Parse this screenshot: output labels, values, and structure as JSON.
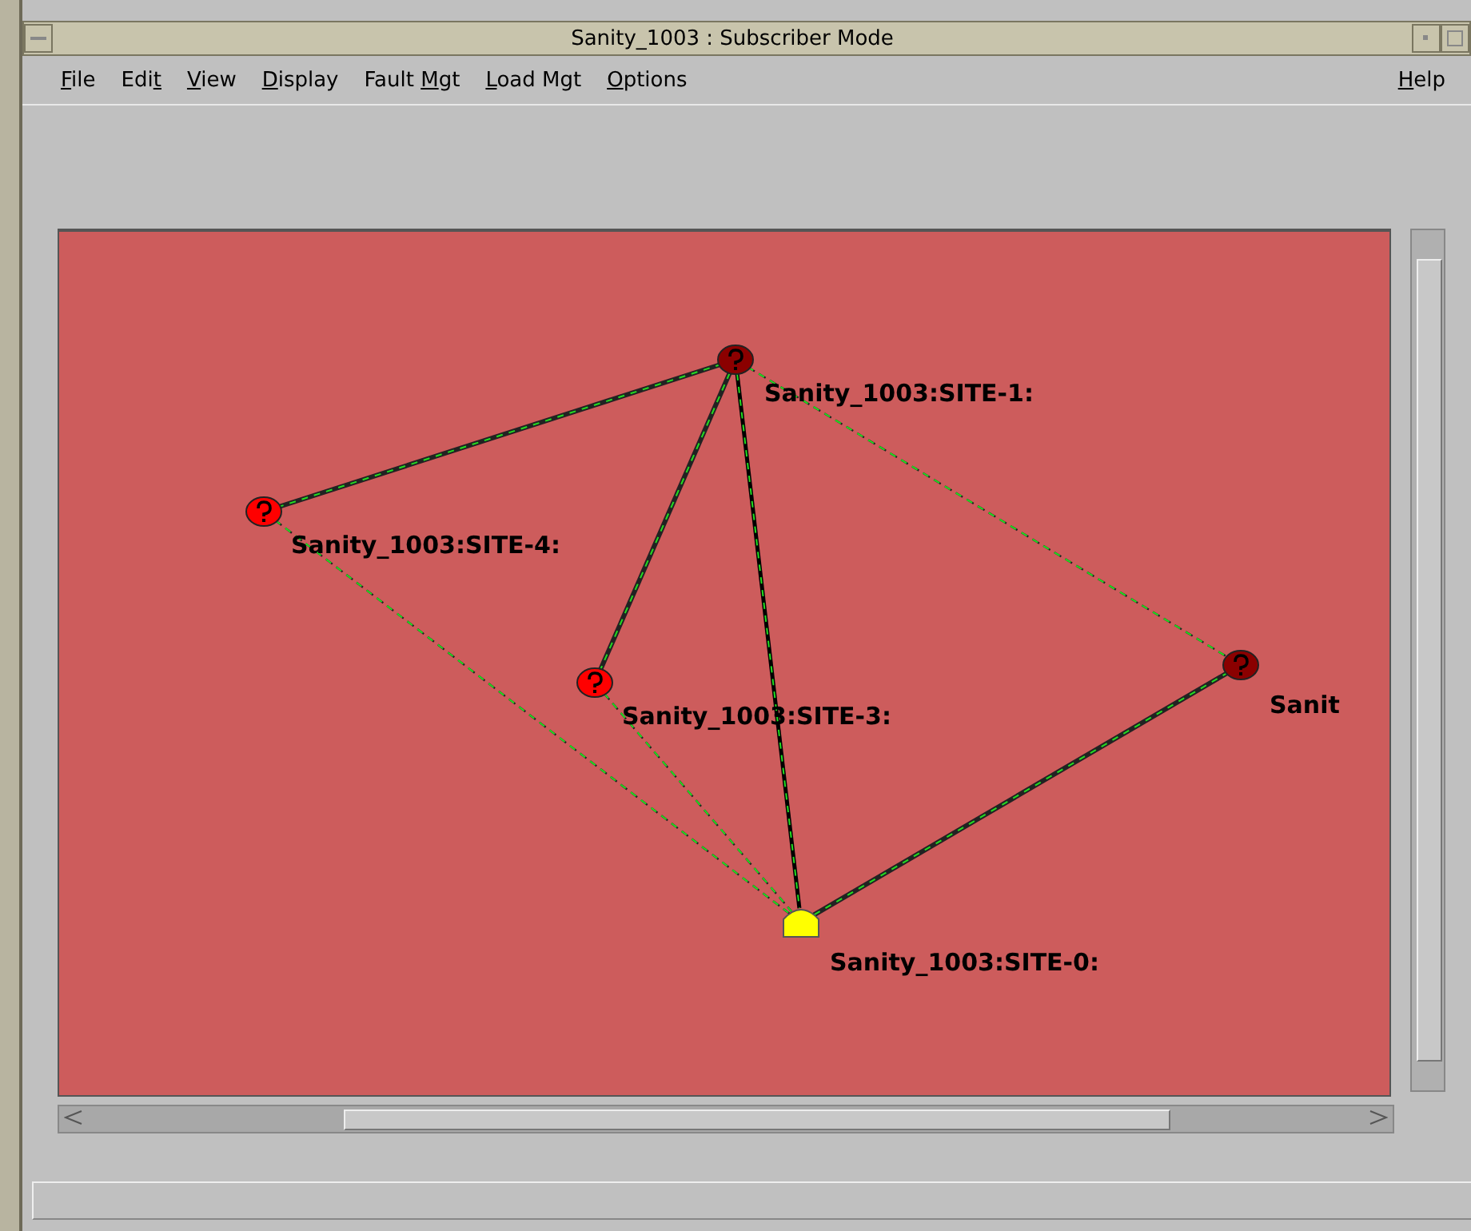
{
  "window": {
    "title": "Sanity_1003 : Subscriber Mode"
  },
  "menu": [
    {
      "parts": [
        {
          "text": "F",
          "underlined": true
        },
        {
          "text": "ile",
          "underlined": false
        }
      ]
    },
    {
      "parts": [
        {
          "text": "Edi",
          "underlined": false
        },
        {
          "text": "t",
          "underlined": true
        }
      ]
    },
    {
      "parts": [
        {
          "text": "V",
          "underlined": true
        },
        {
          "text": "iew",
          "underlined": false
        }
      ]
    },
    {
      "parts": [
        {
          "text": "D",
          "underlined": true
        },
        {
          "text": "isplay",
          "underlined": false
        }
      ]
    },
    {
      "parts": [
        {
          "text": "Fault ",
          "underlined": false
        },
        {
          "text": "M",
          "underlined": true
        },
        {
          "text": "gt",
          "underlined": false
        }
      ]
    },
    {
      "parts": [
        {
          "text": "L",
          "underlined": true
        },
        {
          "text": "oad Mgt",
          "underlined": false
        }
      ]
    },
    {
      "parts": [
        {
          "text": "O",
          "underlined": true
        },
        {
          "text": "ptions",
          "underlined": false
        }
      ]
    }
  ],
  "help_menu": {
    "parts": [
      {
        "text": "H",
        "underlined": true
      },
      {
        "text": "elp",
        "underlined": false
      }
    ]
  },
  "map": {
    "nodes": [
      {
        "kind": "hub",
        "label": "Sanity_1003:SITE-0:",
        "color": "#ffff00"
      },
      {
        "kind": "site",
        "label": "Sanity_1003:SITE-1:",
        "color": "#8b0000"
      },
      {
        "kind": "site",
        "label": "Sanity_1003:SITE-4:",
        "color": "#ff0000"
      },
      {
        "kind": "site",
        "label": "Sanity_1003:SITE-3:",
        "color": "#ff0000"
      },
      {
        "kind": "site",
        "label": "Sanit",
        "color": "#8b0000"
      }
    ],
    "links": [
      {
        "kind": "double"
      },
      {
        "kind": "double"
      },
      {
        "kind": "solid"
      },
      {
        "kind": "dashed"
      },
      {
        "kind": "dashed"
      },
      {
        "kind": "dashed"
      },
      {
        "kind": "double"
      }
    ]
  }
}
